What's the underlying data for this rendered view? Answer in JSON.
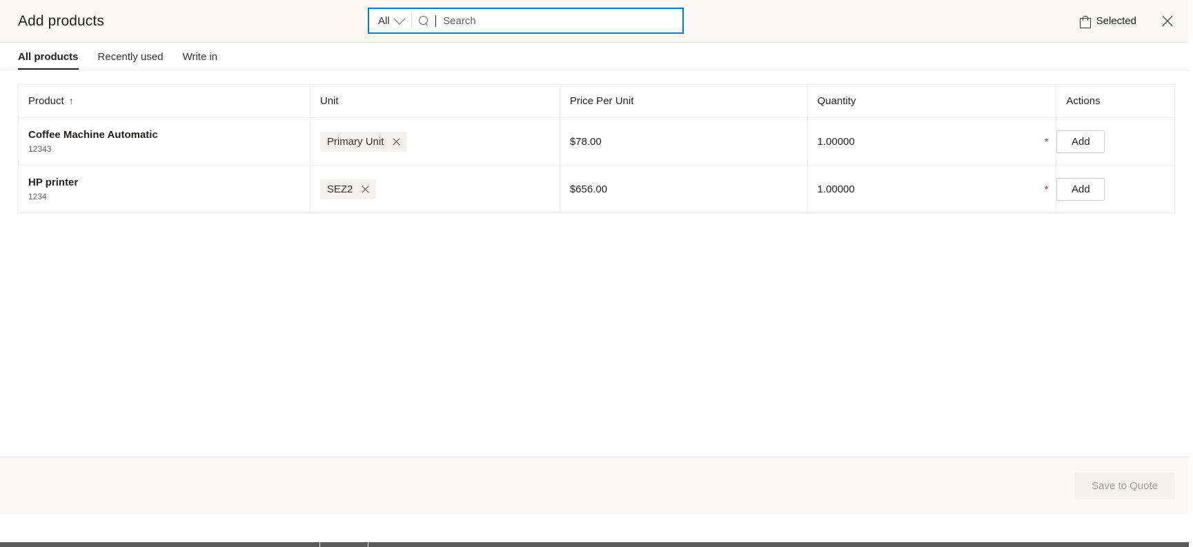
{
  "header": {
    "title": "Add products",
    "search": {
      "scope_label": "All",
      "scope_icon": "chevron-down-icon",
      "search_icon": "search-icon",
      "placeholder": "Search",
      "value": ""
    },
    "selected_label": "Selected",
    "selected_icon": "shopping-bag-icon",
    "close_icon": "close-icon"
  },
  "tabs": [
    {
      "label": "All products",
      "active": true
    },
    {
      "label": "Recently used",
      "active": false
    },
    {
      "label": "Write in",
      "active": false
    }
  ],
  "table": {
    "columns": [
      {
        "label": "Product",
        "sort": "↑"
      },
      {
        "label": "Unit",
        "sort": ""
      },
      {
        "label": "Price Per Unit",
        "sort": ""
      },
      {
        "label": "Quantity",
        "sort": ""
      },
      {
        "label": "Actions",
        "sort": ""
      }
    ],
    "rows": [
      {
        "product_name": "Coffee Machine Automatic",
        "product_code": "12343",
        "unit_chip": "Primary Unit",
        "price_per_unit": "$78.00",
        "quantity": "1.00000",
        "required_marker": "*",
        "action_label": "Add"
      },
      {
        "product_name": "HP printer",
        "product_code": "1234",
        "unit_chip": "SEZ2",
        "price_per_unit": "$656.00",
        "quantity": "1.00000",
        "required_marker": "*",
        "action_label": "Add"
      }
    ]
  },
  "footer": {
    "save_label": "Save to Quote",
    "save_disabled": true
  },
  "colors": {
    "accent": "#0078d4",
    "header_bg": "#faf9f8",
    "border": "#edebe9",
    "chip_bg": "#f3f2f1",
    "required": "#a4262c",
    "text": "#201f1e",
    "text_secondary": "#605e5c"
  }
}
